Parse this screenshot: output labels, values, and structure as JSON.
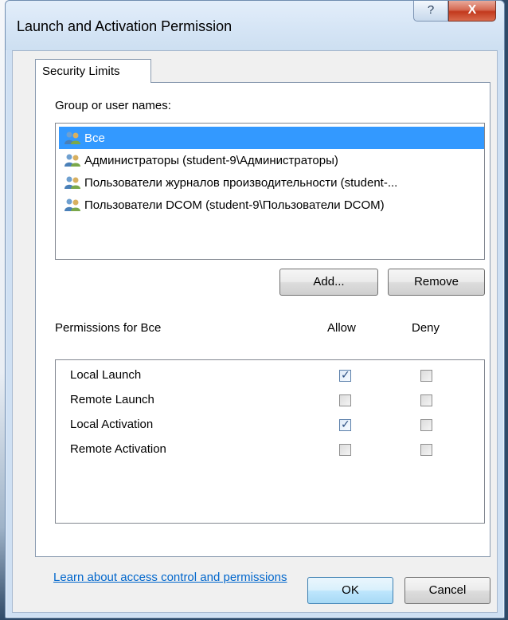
{
  "window": {
    "title": "Launch and Activation Permission",
    "help_label": "?",
    "close_label": "X"
  },
  "tab": {
    "label": "Security Limits"
  },
  "groups": {
    "label": "Group or user names:",
    "items": [
      {
        "label": "Все",
        "selected": true
      },
      {
        "label": "Администраторы (student-9\\Администраторы)",
        "selected": false
      },
      {
        "label": "Пользователи журналов производительности (student-...",
        "selected": false
      },
      {
        "label": "Пользователи DCOM (student-9\\Пользователи DCOM)",
        "selected": false
      }
    ],
    "add_label": "Add...",
    "remove_label": "Remove"
  },
  "permissions": {
    "label": "Permissions for Все",
    "allow_header": "Allow",
    "deny_header": "Deny",
    "rows": [
      {
        "label": "Local Launch",
        "allow": true,
        "deny": false
      },
      {
        "label": "Remote Launch",
        "allow": false,
        "deny": false
      },
      {
        "label": "Local Activation",
        "allow": true,
        "deny": false
      },
      {
        "label": "Remote Activation",
        "allow": false,
        "deny": false
      }
    ]
  },
  "footer": {
    "link_label": "Learn about access control and permissions",
    "ok_label": "OK",
    "cancel_label": "Cancel"
  },
  "colors": {
    "selection": "#3399ff",
    "link": "#0066cc",
    "title_bar": "#d7e6f6",
    "close_button": "#c2391d"
  }
}
